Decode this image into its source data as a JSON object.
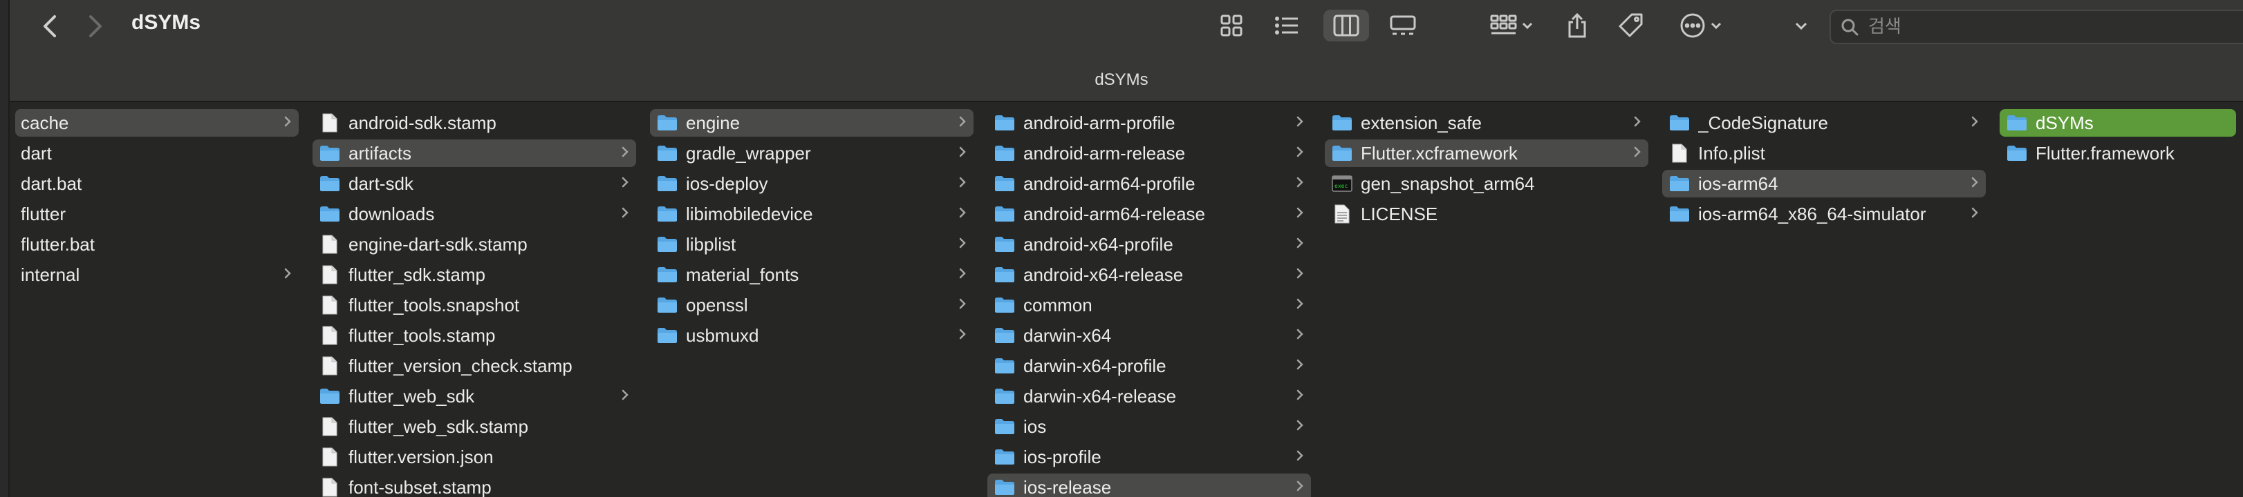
{
  "window": {
    "title": "dSYMs",
    "path_title": "dSYMs"
  },
  "toolbar": {
    "back_icon": "chevron-left-icon",
    "forward_icon": "chevron-right-icon",
    "view_modes": [
      "icon-view-icon",
      "list-view-icon",
      "column-view-icon",
      "gallery-view-icon"
    ],
    "active_view": "column",
    "group_icon": "group-icon",
    "share_icon": "share-icon",
    "tag_icon": "tag-icon",
    "action_icon": "more-icon",
    "search_placeholder": "검색",
    "accent_color": "#5d9b3a"
  },
  "columns": [
    {
      "items": [
        {
          "name": "cache",
          "type": "plain",
          "folder_arrow": true,
          "state": "selected"
        },
        {
          "name": "dart",
          "type": "plain",
          "folder_arrow": false
        },
        {
          "name": "dart.bat",
          "type": "plain",
          "folder_arrow": false
        },
        {
          "name": "flutter",
          "type": "plain",
          "folder_arrow": false
        },
        {
          "name": "flutter.bat",
          "type": "plain",
          "folder_arrow": false
        },
        {
          "name": "internal",
          "type": "plain",
          "folder_arrow": true
        }
      ]
    },
    {
      "items": [
        {
          "name": "android-sdk.stamp",
          "type": "file"
        },
        {
          "name": "artifacts",
          "type": "folder",
          "state": "selected"
        },
        {
          "name": "dart-sdk",
          "type": "folder"
        },
        {
          "name": "downloads",
          "type": "folder"
        },
        {
          "name": "engine-dart-sdk.stamp",
          "type": "file"
        },
        {
          "name": "flutter_sdk.stamp",
          "type": "file"
        },
        {
          "name": "flutter_tools.snapshot",
          "type": "file"
        },
        {
          "name": "flutter_tools.stamp",
          "type": "file"
        },
        {
          "name": "flutter_version_check.stamp",
          "type": "file"
        },
        {
          "name": "flutter_web_sdk",
          "type": "folder"
        },
        {
          "name": "flutter_web_sdk.stamp",
          "type": "file"
        },
        {
          "name": "flutter.version.json",
          "type": "file"
        },
        {
          "name": "font-subset.stamp",
          "type": "file"
        }
      ]
    },
    {
      "items": [
        {
          "name": "engine",
          "type": "folder",
          "state": "selected"
        },
        {
          "name": "gradle_wrapper",
          "type": "folder"
        },
        {
          "name": "ios-deploy",
          "type": "folder"
        },
        {
          "name": "libimobiledevice",
          "type": "folder"
        },
        {
          "name": "libplist",
          "type": "folder"
        },
        {
          "name": "material_fonts",
          "type": "folder"
        },
        {
          "name": "openssl",
          "type": "folder"
        },
        {
          "name": "usbmuxd",
          "type": "folder"
        }
      ]
    },
    {
      "items": [
        {
          "name": "android-arm-profile",
          "type": "folder"
        },
        {
          "name": "android-arm-release",
          "type": "folder"
        },
        {
          "name": "android-arm64-profile",
          "type": "folder"
        },
        {
          "name": "android-arm64-release",
          "type": "folder"
        },
        {
          "name": "android-x64-profile",
          "type": "folder"
        },
        {
          "name": "android-x64-release",
          "type": "folder"
        },
        {
          "name": "common",
          "type": "folder"
        },
        {
          "name": "darwin-x64",
          "type": "folder"
        },
        {
          "name": "darwin-x64-profile",
          "type": "folder"
        },
        {
          "name": "darwin-x64-release",
          "type": "folder"
        },
        {
          "name": "ios",
          "type": "folder"
        },
        {
          "name": "ios-profile",
          "type": "folder"
        },
        {
          "name": "ios-release",
          "type": "folder",
          "state": "selected"
        }
      ]
    },
    {
      "items": [
        {
          "name": "extension_safe",
          "type": "folder"
        },
        {
          "name": "Flutter.xcframework",
          "type": "folder",
          "state": "selected"
        },
        {
          "name": "gen_snapshot_arm64",
          "type": "exec"
        },
        {
          "name": "LICENSE",
          "type": "doc"
        }
      ]
    },
    {
      "items": [
        {
          "name": "_CodeSignature",
          "type": "folder"
        },
        {
          "name": "Info.plist",
          "type": "file"
        },
        {
          "name": "ios-arm64",
          "type": "folder",
          "state": "selected"
        },
        {
          "name": "ios-arm64_x86_64-simulator",
          "type": "folder"
        }
      ]
    },
    {
      "items": [
        {
          "name": "dSYMs",
          "type": "folder",
          "state": "active"
        },
        {
          "name": "Flutter.framework",
          "type": "folder"
        }
      ]
    }
  ]
}
